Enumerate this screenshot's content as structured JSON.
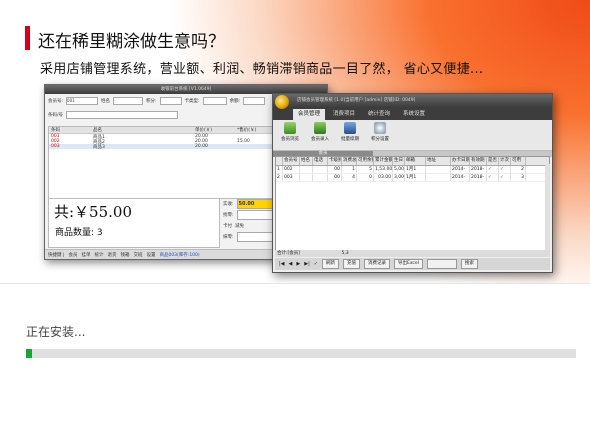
{
  "installer": {
    "headline": "还在稀里糊涂做生意吗？",
    "subline": "采用店铺管理系统，营业额、利润、畅销滞销商品一目了然， 省心又便捷...",
    "status": "正在安装...",
    "progress": 0.01,
    "colors": {
      "accent": "#d0021b",
      "progress": "#14a832",
      "banner": "#f04a18"
    }
  },
  "pos": {
    "title": "收银前台系统 [V1.0649]",
    "labels": {
      "member": "会员号:",
      "name": "姓名",
      "points": "积分:",
      "card": "卡类型:",
      "balance": "余额:",
      "cardno": "条码/号",
      "small": "小票"
    },
    "member_value": "001",
    "columns": [
      "条码",
      "品名",
      "单价(￥)",
      "*售价(￥)",
      "折扣%"
    ],
    "rows": [
      {
        "code": "001",
        "name": "商品1",
        "price": "20.00",
        "sale": "",
        "disc": "100"
      },
      {
        "code": "002",
        "name": "商品2",
        "price": "20.00",
        "sale": "15.00",
        "disc": "100"
      },
      {
        "code": "003",
        "name": "商品3",
        "price": "20.00",
        "sale": "",
        "disc": "100"
      }
    ],
    "total": "共:￥55.00",
    "quantity": "商品数量: 3",
    "pay": {
      "receivable_label": "实收:",
      "receivable": "50.00",
      "change_label": "找零:",
      "card_label": "卡付",
      "discount_label": "减免",
      "minus_label": "抹零:"
    },
    "footer": [
      "快捷键 |",
      "会员",
      "挂单",
      "统计",
      "退货",
      "钱箱",
      "交班",
      "设置"
    ],
    "footer_status": "商品003(库存:100)"
  },
  "members": {
    "title": "店铺会员管理系统 [1.0]当前用户:[admin] 店铺[ID: 0049]",
    "tabs": [
      "会员管理",
      "消费项目",
      "统计查询",
      "系统设置"
    ],
    "active_tab": "会员管理",
    "tools": [
      "会员浏览",
      "会员录入",
      "批量续期",
      "积分设置"
    ],
    "group": "会员",
    "columns": [
      "会员号",
      "姓名",
      "电话",
      "卡级别",
      "消费总计",
      "可用余额",
      "累计金额",
      "生日",
      "邮箱",
      "地址",
      "办卡日期",
      "有效期",
      "是否",
      "计次",
      "可用"
    ],
    "rows": [
      {
        "idx": "1",
        "no": "002",
        "level": "00",
        "count": "1",
        "avail": "5",
        "sum": "1,53.00",
        "money": "5,00",
        "birthday": "1月1",
        "date": "2014-",
        "valid": "2018-",
        "c1": "✓",
        "c2": "✓",
        "left": "2"
      },
      {
        "idx": "2",
        "no": "003",
        "level": "00",
        "count": "4",
        "avail": "0",
        "sum": "03.00",
        "money": "3,00",
        "birthday": "1月1",
        "date": "2014-",
        "valid": "2018-",
        "c1": "✓",
        "c2": "✓",
        "left": "3"
      }
    ],
    "summary": "合计:[会员]",
    "summary_value": "5,3",
    "buttons": [
      "|◀",
      "◀",
      "▶",
      "▶|",
      "✓",
      "刷新",
      "充值",
      "消费记录",
      "导出Excel",
      "搜索"
    ]
  }
}
